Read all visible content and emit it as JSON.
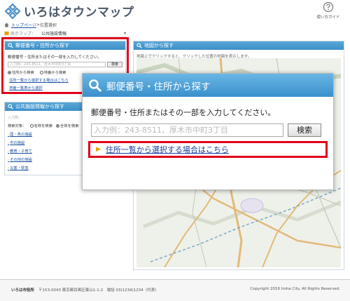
{
  "header": {
    "logo_text": "いろはタウンマップ",
    "guide_label": "使い方ガイド"
  },
  "breadcrumb": {
    "home": "トップページ",
    "separator": " > ",
    "current": "位置選択"
  },
  "map_select": {
    "label": "表示マップ：",
    "value": "公共施設情報"
  },
  "left_search": {
    "title": "郵便番号・住所から探す",
    "description": "郵便番号・住所またはその一部を入力してください。",
    "placeholder": "入力例：243-8511、厚木市中町3丁目",
    "button": "検索",
    "radio_address": "住所から検索",
    "radio_landmark": "地番から検索",
    "link_address_list": "住所一覧から選択する場合はこちら",
    "link_landmark_list": "地番一覧表から選択"
  },
  "facility": {
    "title": "公共施設情報から探す",
    "keyword_placeholder": "入力例：",
    "target_label": "検索対象：",
    "radio_name": "名称を検索",
    "radio_all": "全体を検索",
    "categories": [
      "国・県の施設",
      "市の施設",
      "教育・子育て",
      "その他の施設",
      "災害・緊急"
    ]
  },
  "map_panel": {
    "title": "地図から探す",
    "hint": "地図上でクリックすると、クリックした位置の地図を表示します。"
  },
  "popup": {
    "title": "郵便番号・住所から探す",
    "description": "郵便番号・住所またはその一部を入力してください。",
    "placeholder": "入力例：243-8511、厚木市中町3丁目",
    "button": "検索",
    "link": "住所一覧から選択する場合はこちら"
  },
  "footer": {
    "office": "いろは市役所",
    "address": "〒153-0043 東京都目黒区東山1-1-2　電話 03(1234)1234（代表）",
    "copyright": "Copyright 2016 Iroha City. All Rights Reserved."
  },
  "colors": {
    "accent": "#3b8fc8",
    "highlight": "#e0001a",
    "link": "#1a4fa0"
  }
}
